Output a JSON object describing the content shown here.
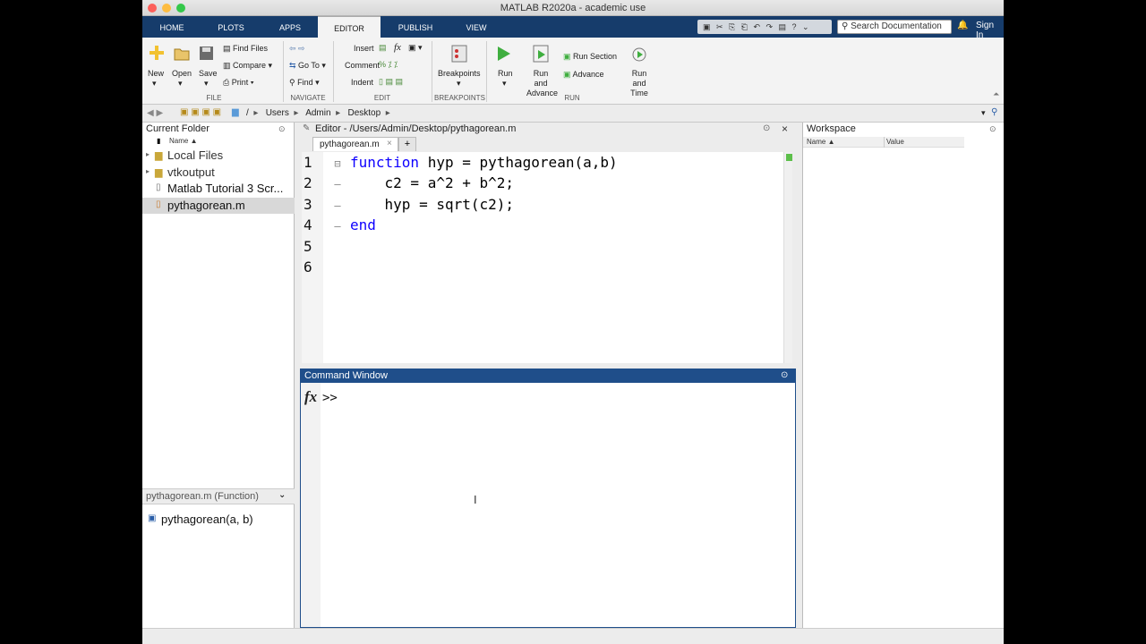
{
  "window": {
    "title": "MATLAB R2020a - academic use"
  },
  "tabs": [
    {
      "label": "HOME"
    },
    {
      "label": "PLOTS"
    },
    {
      "label": "APPS"
    },
    {
      "label": "EDITOR"
    },
    {
      "label": "PUBLISH"
    },
    {
      "label": "VIEW"
    }
  ],
  "search": {
    "placeholder": "Search Documentation"
  },
  "signin": "Sign In",
  "ribbon": {
    "file": {
      "new": "New",
      "open": "Open",
      "save": "Save",
      "find_files": "Find Files",
      "compare": "Compare",
      "print": "Print",
      "group": "FILE"
    },
    "navigate": {
      "go_to": "Go To",
      "find": "Find",
      "group": "NAVIGATE"
    },
    "edit": {
      "insert": "Insert",
      "comment": "Comment",
      "indent": "Indent",
      "group": "EDIT",
      "fx": "fx"
    },
    "breakpoints": {
      "label": "Breakpoints",
      "group": "BREAKPOINTS"
    },
    "run": {
      "run": "Run",
      "run_and_advance": "Run and Advance",
      "run_section": "Run Section",
      "advance": "Advance",
      "run_and_time": "Run and Time",
      "group": "RUN"
    }
  },
  "address": {
    "path": [
      "/",
      "Users",
      "Admin",
      "Desktop"
    ]
  },
  "current_folder": {
    "title": "Current Folder",
    "column": "Name ▲",
    "items": [
      {
        "name": "Local Files",
        "type": "folder"
      },
      {
        "name": "vtkoutput",
        "type": "folder"
      },
      {
        "name": "Matlab Tutorial 3 Scr...",
        "type": "file"
      },
      {
        "name": "pythagorean.m",
        "type": "mfile"
      }
    ],
    "details_header": "pythagorean.m  (Function)",
    "details_item": "pythagorean(a, b)"
  },
  "editor": {
    "title": "Editor - /Users/Admin/Desktop/pythagorean.m",
    "tab": "pythagorean.m",
    "lines": [
      {
        "n": "1",
        "kw": "function",
        "rest": " hyp = pythagorean(a,b)"
      },
      {
        "n": "2",
        "kw": "",
        "rest": "    c2 = a^2 + b^2;"
      },
      {
        "n": "3",
        "kw": "",
        "rest": "    hyp = sqrt(c2);"
      },
      {
        "n": "4",
        "kw": "end",
        "rest": ""
      },
      {
        "n": "5",
        "kw": "",
        "rest": ""
      },
      {
        "n": "6",
        "kw": "",
        "rest": ""
      }
    ]
  },
  "command_window": {
    "title": "Command Window",
    "fx": "fx",
    "prompt": ">>"
  },
  "workspace": {
    "title": "Workspace",
    "col_name": "Name ▲",
    "col_value": "Value"
  },
  "colors": {
    "tabbar": "#163c6b",
    "cmd_header": "#1f4e8a",
    "keyword": "#0e00ff"
  }
}
